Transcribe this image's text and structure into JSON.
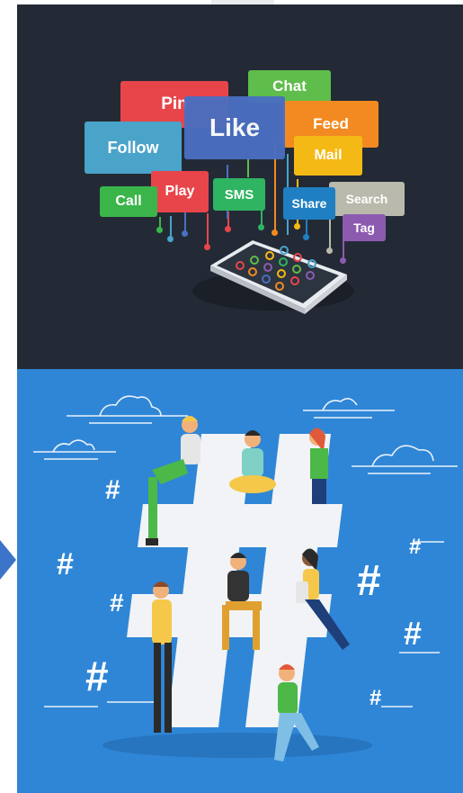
{
  "top_panel": {
    "bubbles": [
      {
        "label": "Pin",
        "color": "#e8454a"
      },
      {
        "label": "Chat",
        "color": "#5fbd4b"
      },
      {
        "label": "Like",
        "color": "#4a6fc1"
      },
      {
        "label": "Feed",
        "color": "#f28a21"
      },
      {
        "label": "Follow",
        "color": "#4aa3c9"
      },
      {
        "label": "Mail",
        "color": "#f5b915"
      },
      {
        "label": "Play",
        "color": "#e8454a"
      },
      {
        "label": "SMS",
        "color": "#2fb461"
      },
      {
        "label": "Call",
        "color": "#3bb54a"
      },
      {
        "label": "Share",
        "color": "#1f7fc2"
      },
      {
        "label": "Search",
        "color": "#b9b9ac"
      },
      {
        "label": "Tag",
        "color": "#8c5bb0"
      }
    ]
  },
  "bottom_panel": {
    "hash_symbol": "#",
    "colors": {
      "background": "#2f86d6",
      "hash_big": "#f1f3f6"
    }
  }
}
